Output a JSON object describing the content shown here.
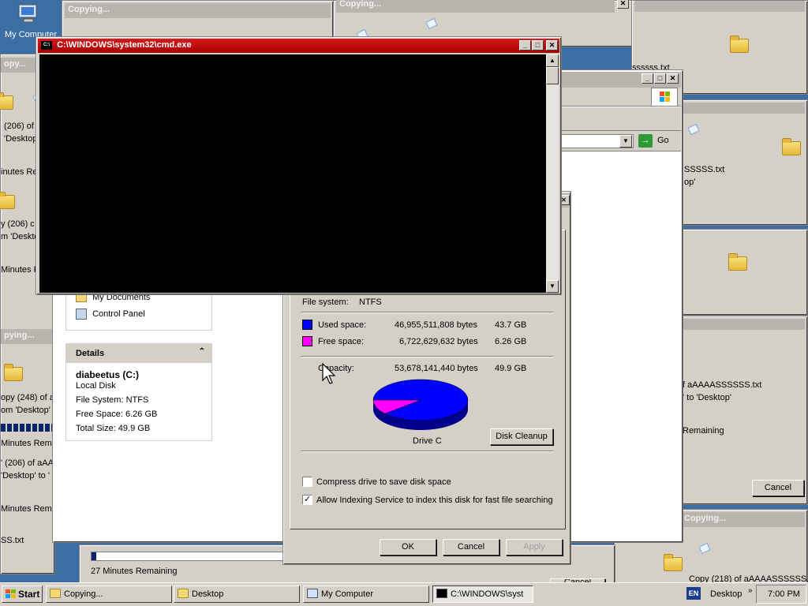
{
  "desktop": {
    "my_computer_label": "My Computer"
  },
  "copy_dialogs": {
    "title": "Copying...",
    "partial_texts": {
      "l1": "(206) of",
      "l2": "'Desktop",
      "l3": "inutes Re",
      "l4": "y (206) c",
      "l5": "m 'Deskto",
      "l6": "Minutes R",
      "l7": "pying...",
      "l8": "opy (248) of a",
      "l9": "om 'Desktop' t",
      "l10": "Minutes Rema",
      "l11": "' (206) of aAA",
      "l12": "'Desktop' to '",
      "l13": "Minutes Remain",
      "l14": "SS.txt",
      "r1": "SSSSS.txt",
      "r2": "ssssss.txt",
      "r3": "op'",
      "r4": "f aAAAASSSSSS.txt",
      "r5": "' to 'Desktop'",
      "r6": "Remaining",
      "r7": "Copy (218) of aAAAASSSSSS.txt"
    },
    "minutes_remaining": "27 Minutes Remaining",
    "cancel_label": "Cancel",
    "cancel_partial": "Cancel"
  },
  "cmd": {
    "title": "C:\\WINDOWS\\system32\\cmd.exe",
    "icon_text": "C:\\"
  },
  "explorer": {
    "go_label": "Go",
    "other_places": {
      "items": [
        "My Documents",
        "Control Panel"
      ]
    },
    "details": {
      "header": "Details",
      "name": "diabeetus (C:)",
      "type": "Local Disk",
      "file_system": "File System: NTFS",
      "free_space": "Free Space: 6.26 GB",
      "total_size": "Total Size: 49.9 GB"
    }
  },
  "properties": {
    "file_system_label": "File system:",
    "file_system_value": "NTFS",
    "used_label": "Used space:",
    "used_bytes": "46,955,511,808 bytes",
    "used_gb": "43.7 GB",
    "free_label": "Free space:",
    "free_bytes": "6,722,629,632 bytes",
    "free_gb": "6.26 GB",
    "capacity_label": "Capacity:",
    "capacity_bytes": "53,678,141,440 bytes",
    "capacity_gb": "49.9 GB",
    "drive_label": "Drive C",
    "disk_cleanup": "Disk Cleanup",
    "compress_label": "Compress drive to save disk space",
    "index_label": "Allow Indexing Service to index this disk for fast file searching",
    "ok": "OK",
    "cancel": "Cancel",
    "apply": "Apply",
    "used_fraction": 0.875,
    "used_color": "#0000ff",
    "free_color": "#ff00ff"
  },
  "taskbar": {
    "start": "Start",
    "buttons": [
      "Copying...",
      "Desktop",
      "My Computer",
      "C:\\WINDOWS\\syst"
    ],
    "language": "EN",
    "desktop_label": "Desktop",
    "clock": "7:00 PM"
  }
}
